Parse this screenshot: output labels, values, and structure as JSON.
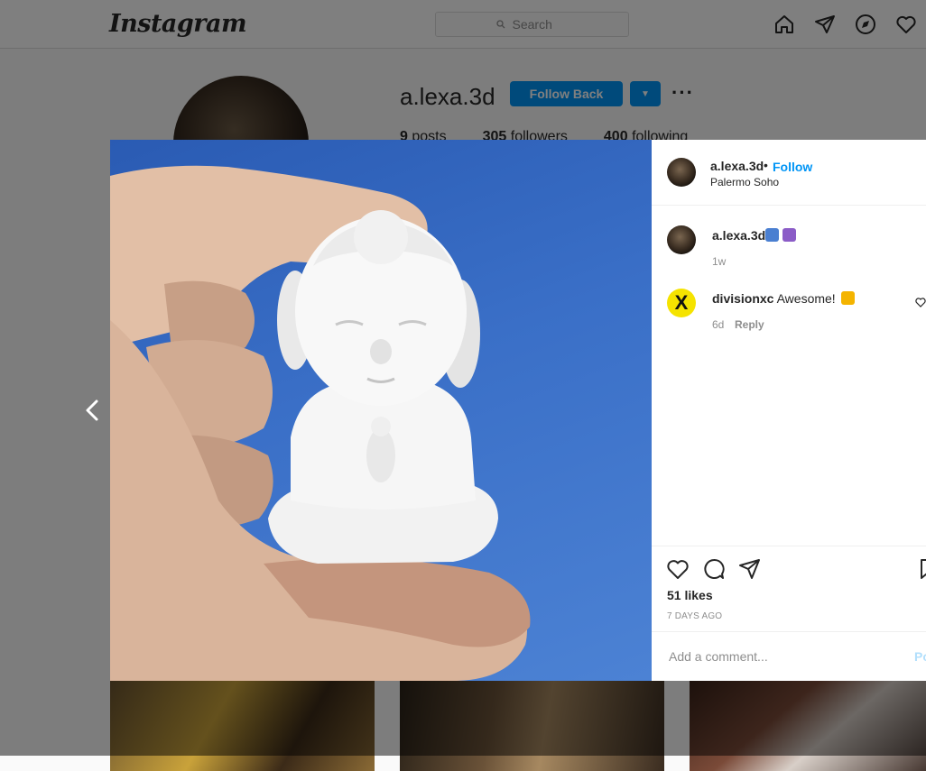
{
  "header": {
    "logo": "Instagram",
    "search_placeholder": "Search",
    "nav_icons": [
      "home-icon",
      "direct-icon",
      "explore-icon",
      "activity-icon"
    ]
  },
  "profile": {
    "username": "a.lexa.3d",
    "follow_back_label": "Follow Back",
    "stats": {
      "posts": "9",
      "posts_label": "posts",
      "followers": "305",
      "followers_label": "followers",
      "following": "400",
      "following_label": "following"
    }
  },
  "post": {
    "author": "a.lexa.3d",
    "follow_label": "Follow",
    "separator": "•",
    "location": "Palermo Soho",
    "caption_user": "a.lexa.3d",
    "caption_emojis": [
      "woman-technologist-emoji",
      "om-symbol-emoji"
    ],
    "caption_time": "1w",
    "comments": [
      {
        "user": "divisionxc",
        "text": "Awesome!",
        "emoji": "raising-hands-emoji",
        "avatar_letter": "X",
        "time": "6d",
        "reply_label": "Reply"
      }
    ],
    "likes": "51 likes",
    "timestamp": "7 DAYS AGO",
    "comment_placeholder": "Add a comment...",
    "post_label": "Post"
  },
  "colors": {
    "accent": "#0095f6",
    "sky_blue": "#3a6fc7",
    "divisionxc_avatar": "#f5e300"
  }
}
